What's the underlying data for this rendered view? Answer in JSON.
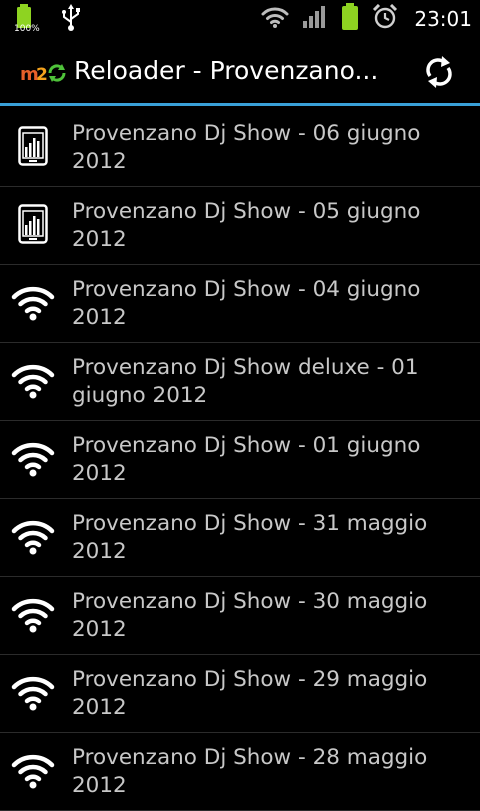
{
  "status_bar": {
    "battery_small_percent": "100%",
    "time": "23:01",
    "icons": [
      "battery-icon",
      "usb-icon",
      "wifi-icon",
      "signal-icon",
      "battery-icon",
      "alarm-icon"
    ]
  },
  "action_bar": {
    "logo_text": "M2O",
    "title": "Reloader - Provenzano...",
    "refresh_icon": "refresh-icon"
  },
  "list": {
    "items": [
      {
        "icon": "phone-icon",
        "line1": "Provenzano Dj Show - 06 giugno",
        "line2": "2012"
      },
      {
        "icon": "phone-icon",
        "line1": "Provenzano Dj Show - 05 giugno",
        "line2": "2012"
      },
      {
        "icon": "wifi-icon",
        "line1": "Provenzano Dj Show - 04 giugno",
        "line2": "2012"
      },
      {
        "icon": "wifi-icon",
        "line1": "Provenzano Dj Show deluxe - 01",
        "line2": "giugno 2012"
      },
      {
        "icon": "wifi-icon",
        "line1": "Provenzano Dj Show - 01 giugno",
        "line2": "2012"
      },
      {
        "icon": "wifi-icon",
        "line1": "Provenzano Dj Show - 31 maggio",
        "line2": "2012"
      },
      {
        "icon": "wifi-icon",
        "line1": "Provenzano Dj Show - 30 maggio",
        "line2": "2012"
      },
      {
        "icon": "wifi-icon",
        "line1": "Provenzano Dj Show - 29 maggio",
        "line2": "2012"
      },
      {
        "icon": "wifi-icon",
        "line1": "Provenzano Dj Show - 28 maggio",
        "line2": "2012"
      }
    ]
  },
  "colors": {
    "accent": "#39a0d8",
    "battery_green": "#8ed321",
    "background": "#000000",
    "text_primary": "#ffffff",
    "text_list": "#c8c8c8"
  }
}
